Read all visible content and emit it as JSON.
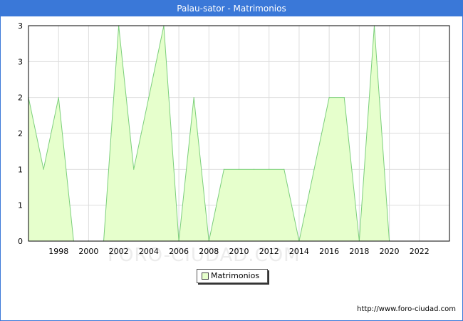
{
  "window": {
    "title": "Palau-sator - Matrimonios"
  },
  "footer": {
    "url": "http://www.foro-ciudad.com"
  },
  "watermark": {
    "text": "FORO-CIUDAD.COM"
  },
  "legend": {
    "label": "Matrimonios"
  },
  "colors": {
    "fill": "#e6ffcc",
    "line": "#7ccf7c",
    "title_bar": "#3a78d8",
    "grid": "#dddddd"
  },
  "chart_data": {
    "type": "area",
    "title": "Palau-sator - Matrimonios",
    "xlabel": "",
    "ylabel": "",
    "x": [
      1996,
      1997,
      1998,
      1999,
      2000,
      2001,
      2002,
      2003,
      2004,
      2005,
      2006,
      2007,
      2008,
      2009,
      2010,
      2011,
      2012,
      2013,
      2014,
      2015,
      2016,
      2017,
      2018,
      2019,
      2020
    ],
    "series": [
      {
        "name": "Matrimonios",
        "values": [
          2,
          1,
          2,
          0,
          0,
          0,
          3,
          1,
          2,
          3,
          0,
          2,
          0,
          1,
          1,
          1,
          1,
          1,
          0,
          1,
          2,
          2,
          0,
          3,
          0
        ]
      }
    ],
    "xlim": [
      1996,
      2024
    ],
    "ylim": [
      0,
      3
    ],
    "x_ticks": [
      "1998",
      "2000",
      "2002",
      "2004",
      "2006",
      "2008",
      "2010",
      "2012",
      "2014",
      "2016",
      "2018",
      "2020",
      "2022"
    ],
    "y_tick_labels": [
      "0",
      "1",
      "1",
      "2",
      "2",
      "3",
      "3"
    ],
    "grid": true,
    "legend_position": "bottom-center"
  }
}
